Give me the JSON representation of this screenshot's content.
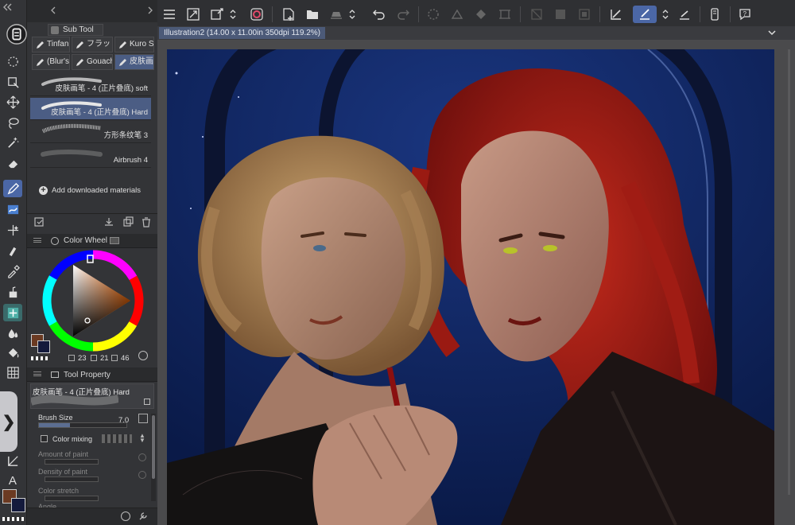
{
  "document_tab": "Illustration2 (14.00 x 11.00in 350dpi 119.2%)",
  "sub_tool": {
    "panel_title": "Sub Tool",
    "tabs": [
      "Tinfan",
      "フラッ",
      "Kuro S",
      "(Blur's",
      "Gouach",
      "皮肤画"
    ],
    "active_tab": "皮肤画",
    "brushes": [
      {
        "label": "皮肤画笔 - 4 (正片叠底) soft",
        "selected": false
      },
      {
        "label": "皮肤画笔 - 4 (正片叠底) Hard",
        "selected": true
      },
      {
        "label": "方形条纹笔 3",
        "selected": false
      },
      {
        "label": "Airbrush 4",
        "selected": false
      }
    ],
    "add_materials": "Add downloaded materials"
  },
  "color_wheel": {
    "panel_title": "Color Wheel",
    "main_color": "#6b3a22",
    "sub_color": "#141a3c",
    "h": "23",
    "s": "21",
    "v": "46"
  },
  "tool_property": {
    "panel_title": "Tool Property",
    "brush_name": "皮肤画笔 - 4 (正片叠底) Hard",
    "brush_size_label": "Brush Size",
    "brush_size_value": "7.0",
    "color_mixing_label": "Color mixing",
    "amount_of_paint_label": "Amount of paint",
    "density_of_paint_label": "Density of paint",
    "color_stretch_label": "Color stretch",
    "angle_label": "Angle",
    "brush_size_fraction": 0.35
  },
  "tools": [
    "undo-history",
    "lasso-select",
    "layer-move",
    "move",
    "lasso",
    "magic-wand",
    "eraser",
    "pen",
    "blend",
    "sparkle",
    "fill-tool",
    "eyedropper",
    "ink-bottle",
    "figure",
    "blur",
    "bucket",
    "grid",
    "ruler",
    "text",
    "sub-color-swatch"
  ],
  "colors": {
    "accent": "#4b67a6",
    "panel": "#333437",
    "toolbar": "#2f3033"
  }
}
